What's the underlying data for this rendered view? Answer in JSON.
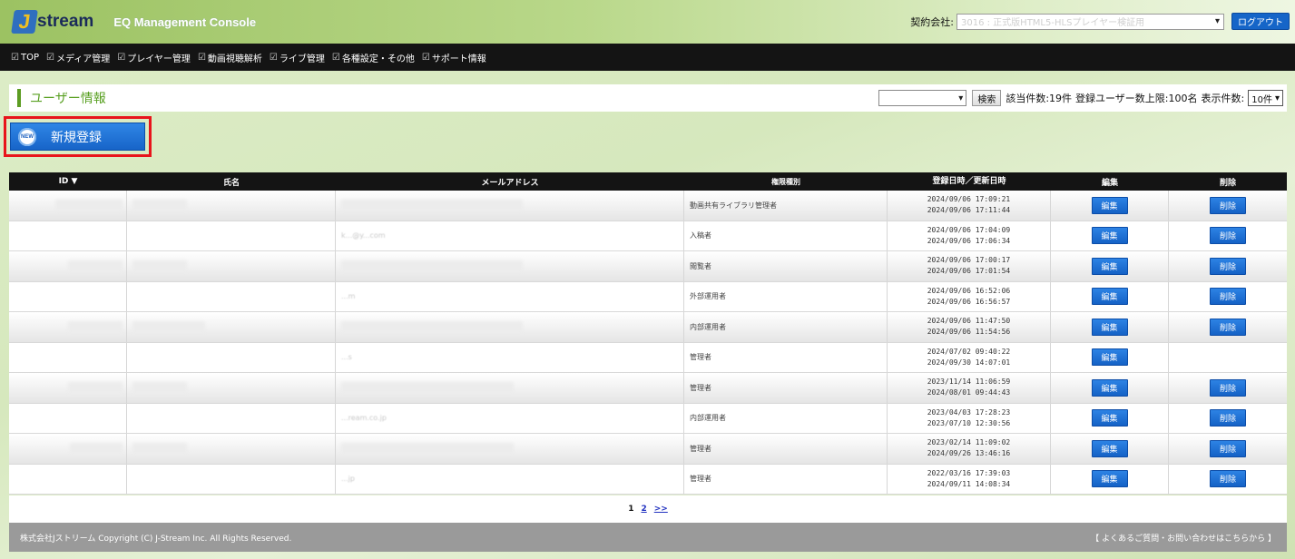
{
  "header": {
    "logo_mark": "J",
    "logo_text": "stream",
    "console_title": "EQ Management Console",
    "contract_label": "契約会社:",
    "contract_value": "3016 : 正式版HTML5-HLSプレイヤー検証用",
    "logout_label": "ログアウト"
  },
  "nav": {
    "items": [
      {
        "label": "TOP"
      },
      {
        "label": "メディア管理"
      },
      {
        "label": "プレイヤー管理"
      },
      {
        "label": "動画視聴解析"
      },
      {
        "label": "ライブ管理"
      },
      {
        "label": "各種設定・その他"
      },
      {
        "label": "サポート情報"
      }
    ]
  },
  "page": {
    "title": "ユーザー情報",
    "search_label": "検索",
    "hit_count": "該当件数:19件",
    "user_limit": "登録ユーザー数上限:100名",
    "per_page_label": "表示件数:",
    "per_page_value": "10件"
  },
  "new_button": {
    "badge": "NEW",
    "label": "新規登録"
  },
  "table": {
    "columns": [
      "ID ▼",
      "氏名",
      "メールアドレス",
      "権限種別",
      "登録日時／更新日時",
      "編集",
      "削除"
    ],
    "edit_label": "編集",
    "delete_label": "削除",
    "rows": [
      {
        "role": "動画共有ライブラリ管理者",
        "registered": "2024/09/06 17:09:21",
        "updated": "2024/09/06 17:11:44",
        "can_delete": true,
        "mail_hint": "k@..."
      },
      {
        "role": "入稿者",
        "registered": "2024/09/06 17:04:09",
        "updated": "2024/09/06 17:06:34",
        "can_delete": true,
        "mail_hint": "k...@y...com"
      },
      {
        "role": "閲覧者",
        "registered": "2024/09/06 17:00:17",
        "updated": "2024/09/06 17:01:54",
        "can_delete": true,
        "mail_hint": "k@...com"
      },
      {
        "role": "外部運用者",
        "registered": "2024/09/06 16:52:06",
        "updated": "2024/09/06 16:56:57",
        "can_delete": true,
        "mail_hint": "...m"
      },
      {
        "role": "内部運用者",
        "registered": "2024/09/06 11:47:50",
        "updated": "2024/09/06 11:54:56",
        "can_delete": true,
        "mail_hint": ""
      },
      {
        "role": "管理者",
        "registered": "2024/07/02 09:40:22",
        "updated": "2024/09/30 14:07:01",
        "can_delete": false,
        "mail_hint": "...s"
      },
      {
        "role": "管理者",
        "registered": "2023/11/14 11:06:59",
        "updated": "2024/08/01 09:44:43",
        "can_delete": true,
        "mail_hint": ""
      },
      {
        "role": "内部運用者",
        "registered": "2023/04/03 17:28:23",
        "updated": "2023/07/10 12:30:56",
        "can_delete": true,
        "mail_hint": "...ream.co.jp"
      },
      {
        "role": "管理者",
        "registered": "2023/02/14 11:09:02",
        "updated": "2024/09/26 13:46:16",
        "can_delete": true,
        "mail_hint": ""
      },
      {
        "role": "管理者",
        "registered": "2022/03/16 17:39:03",
        "updated": "2024/09/11 14:08:34",
        "can_delete": true,
        "mail_hint": "...jp"
      }
    ]
  },
  "pager": {
    "current": "1",
    "page2": "2",
    "next": ">>"
  },
  "footer": {
    "copyright": "株式会社Jストリーム Copyright (C) J-Stream Inc. All Rights Reserved.",
    "support_link": "【 よくあるご質問・お問い合わせはこちらから 】"
  }
}
